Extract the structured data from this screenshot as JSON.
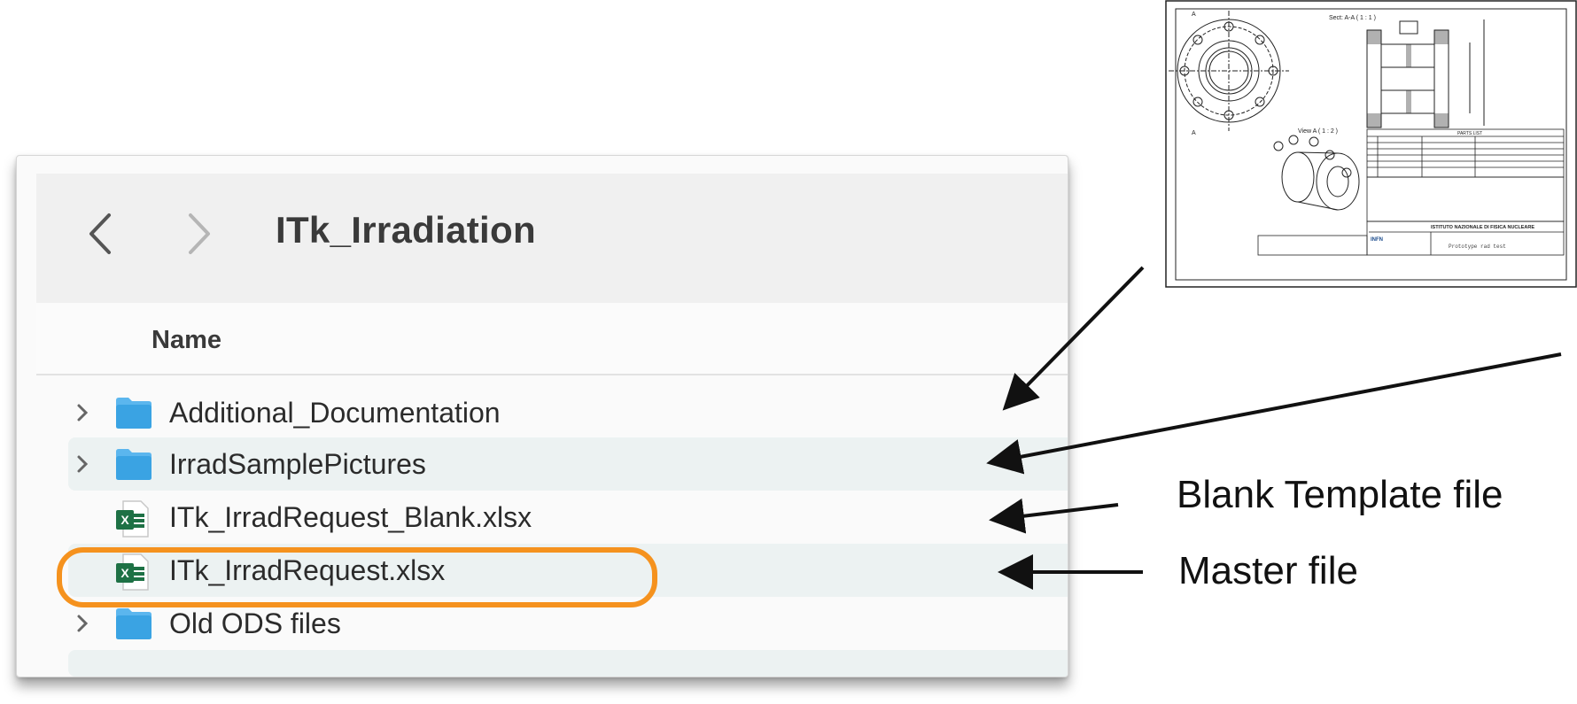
{
  "window": {
    "title": "ITk_Irradiation",
    "column_header": "Name",
    "back_icon": "chevron-left-icon",
    "forward_icon": "chevron-right-icon"
  },
  "files": [
    {
      "name": "Additional_Documentation",
      "kind": "folder"
    },
    {
      "name": "IrradSamplePictures",
      "kind": "folder"
    },
    {
      "name": "ITk_IrradRequest_Blank.xlsx",
      "kind": "excel"
    },
    {
      "name": "ITk_IrradRequest.xlsx",
      "kind": "excel"
    },
    {
      "name": "Old ODS files",
      "kind": "folder"
    }
  ],
  "annotations": {
    "blank_label": "Blank Template file",
    "master_label": "Master file",
    "highlight_color": "#f5921e"
  },
  "drawing": {
    "section_title": "Sect: A-A ( 1 : 1 )",
    "view_title": "View A ( 1 : 2 )",
    "parts_list_title": "PARTS LIST",
    "institute": "ISTITUTO NAZIONALE DI FISICA NUCLEARE",
    "logo": "INFN",
    "caption": "Prototype rad test"
  },
  "colors": {
    "folder": "#3aa3e3",
    "excel_green": "#1e7145",
    "row_alt": "#ecf2f2"
  }
}
